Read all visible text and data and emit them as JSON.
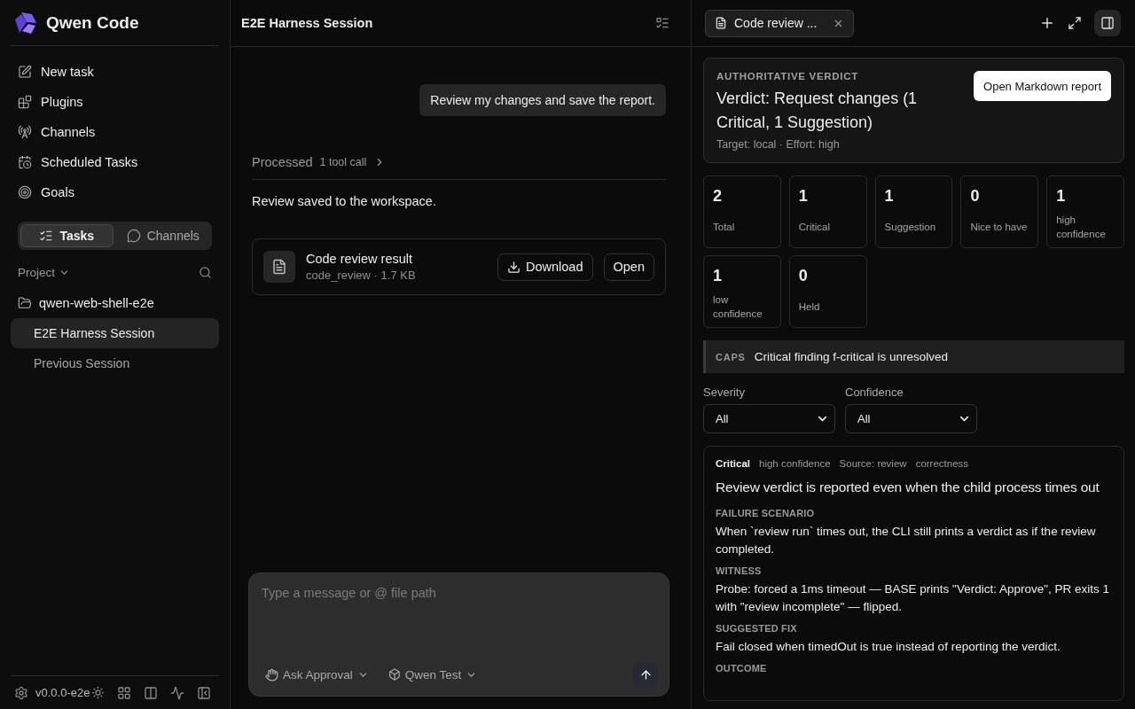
{
  "sidebar": {
    "brand": "Qwen Code",
    "nav": [
      {
        "label": "New task"
      },
      {
        "label": "Plugins"
      },
      {
        "label": "Channels"
      },
      {
        "label": "Scheduled Tasks"
      },
      {
        "label": "Goals"
      }
    ],
    "tabs": [
      {
        "label": "Tasks",
        "selected": true
      },
      {
        "label": "Channels",
        "selected": false
      }
    ],
    "section_label": "Project",
    "project": {
      "name": "qwen-web-shell-e2e",
      "sessions": [
        {
          "label": "E2E Harness Session",
          "selected": true
        },
        {
          "label": "Previous Session",
          "selected": false
        }
      ]
    },
    "version": "v0.0.0-e2e"
  },
  "chat": {
    "title": "E2E Harness Session",
    "user_message": "Review my changes and save the report.",
    "processed": {
      "label": "Processed",
      "count": "1 tool call"
    },
    "reply": "Review saved to the workspace.",
    "attachment": {
      "title": "Code review result",
      "meta": "code_review · 1.7 KB",
      "buttons": [
        "Download",
        "Open"
      ]
    },
    "composer": {
      "placeholder": "Type a message or @ file path",
      "mode": "Ask Approval",
      "model": "Qwen Test"
    }
  },
  "panel": {
    "tab": {
      "title": "Code review ..."
    },
    "verdict": {
      "eyebrow": "AUTHORITATIVE VERDICT",
      "title": "Verdict: Request changes (1 Critical, 1 Suggestion)",
      "meta": "Target: local · Effort: high",
      "button": "Open Markdown report"
    },
    "stats": [
      {
        "value": "2",
        "label": "Total"
      },
      {
        "value": "1",
        "label": "Critical"
      },
      {
        "value": "1",
        "label": "Suggestion"
      },
      {
        "value": "0",
        "label": "Nice to have"
      },
      {
        "value": "1",
        "label": "high confidence"
      },
      {
        "value": "1",
        "label": "low confidence"
      },
      {
        "value": "0",
        "label": "Held"
      }
    ],
    "caps": {
      "tag": "CAPS",
      "text": "Critical finding f-critical is unresolved"
    },
    "filters": [
      {
        "label": "Severity",
        "value": "All"
      },
      {
        "label": "Confidence",
        "value": "All"
      }
    ],
    "finding": {
      "severity": "Critical",
      "tags": [
        "high confidence",
        "Source: review",
        "correctness"
      ],
      "title": "Review verdict is reported even when the child process times out",
      "sections": [
        {
          "heading": "FAILURE SCENARIO",
          "body": "When `review run` times out, the CLI still prints a verdict as if the review completed."
        },
        {
          "heading": "WITNESS",
          "body": "Probe: forced a 1ms timeout — BASE prints \"Verdict: Approve\", PR exits 1 with \"review incomplete\" — flipped."
        },
        {
          "heading": "SUGGESTED FIX",
          "body": "Fail closed when timedOut is true instead of reporting the verdict."
        },
        {
          "heading": "OUTCOME"
        }
      ]
    }
  }
}
